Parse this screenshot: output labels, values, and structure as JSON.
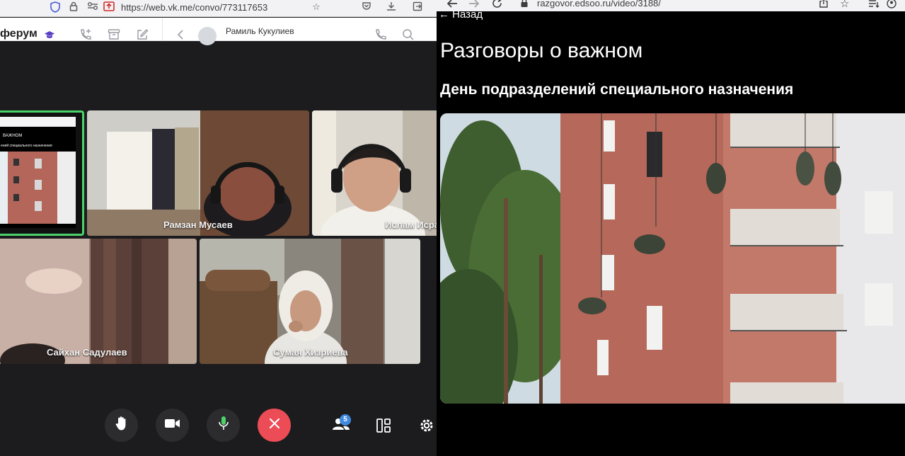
{
  "left_window": {
    "url": "https://web.vk.me/convo/773117653",
    "app_title": "ферум",
    "contact_name": "Рамиль Кукулиев",
    "shared_screen": {
      "title": "ВАЖНОМ",
      "subtitle": "ений специального назначения"
    },
    "participants": [
      {
        "name": "Рамзан Мусаев"
      },
      {
        "name": "Ислам Исра"
      },
      {
        "name": "Сайхан Садулаев"
      },
      {
        "name": "Сумая Хизриева"
      }
    ],
    "controls": {
      "participants_count": "5"
    }
  },
  "right_window": {
    "url": "razgovor.edsoo.ru/video/3188/",
    "back_label": "← Назад",
    "title": "Разговоры о важном",
    "subtitle": "День подразделений специального назначения"
  },
  "colors": {
    "accent_green": "#4bd36a",
    "end_call_red": "#ec4c56",
    "badge_blue": "#3f8ae0",
    "vk_purple": "#5b3fc9"
  }
}
